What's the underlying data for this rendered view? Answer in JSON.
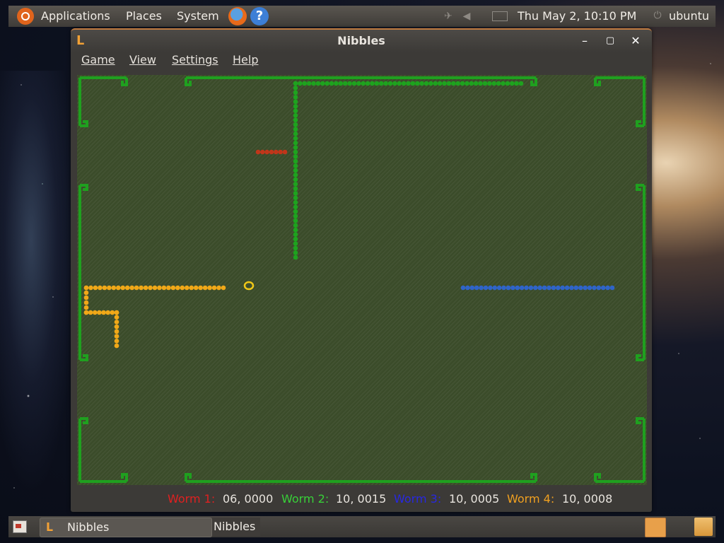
{
  "top_panel": {
    "menus": [
      "Applications",
      "Places",
      "System"
    ],
    "clock": "Thu May  2, 10:10 PM",
    "user": "ubuntu",
    "icons": [
      "ubuntu-logo-icon",
      "firefox-icon",
      "help-icon",
      "network-icon",
      "volume-icon",
      "mail-icon",
      "power-icon"
    ]
  },
  "window": {
    "title": "Nibbles",
    "menu": [
      "Game",
      "View",
      "Settings",
      "Help"
    ],
    "buttons": [
      "minimize",
      "maximize",
      "close"
    ]
  },
  "game": {
    "colors": {
      "wall": "#1fa01f",
      "worm1": "#c0361a",
      "worm2": "#1ea21e",
      "worm3": "#2f64c8",
      "worm4": "#f0a818",
      "bonus": "#f0c818"
    }
  },
  "status": {
    "worm1_label": "Worm 1:",
    "worm1_value": "06, 0000",
    "worm2_label": "Worm 2:",
    "worm2_value": "10, 0015",
    "worm3_label": "Worm 3:",
    "worm3_value": "10, 0005",
    "worm4_label": "Worm 4:",
    "worm4_value": "10, 0008",
    "colors": {
      "worm1": "#e02020",
      "worm2": "#38d038",
      "worm3": "#2828e0",
      "worm4": "#f0a020"
    }
  },
  "taskbar": {
    "items": [
      "Nibbles",
      "Nibbles"
    ]
  }
}
